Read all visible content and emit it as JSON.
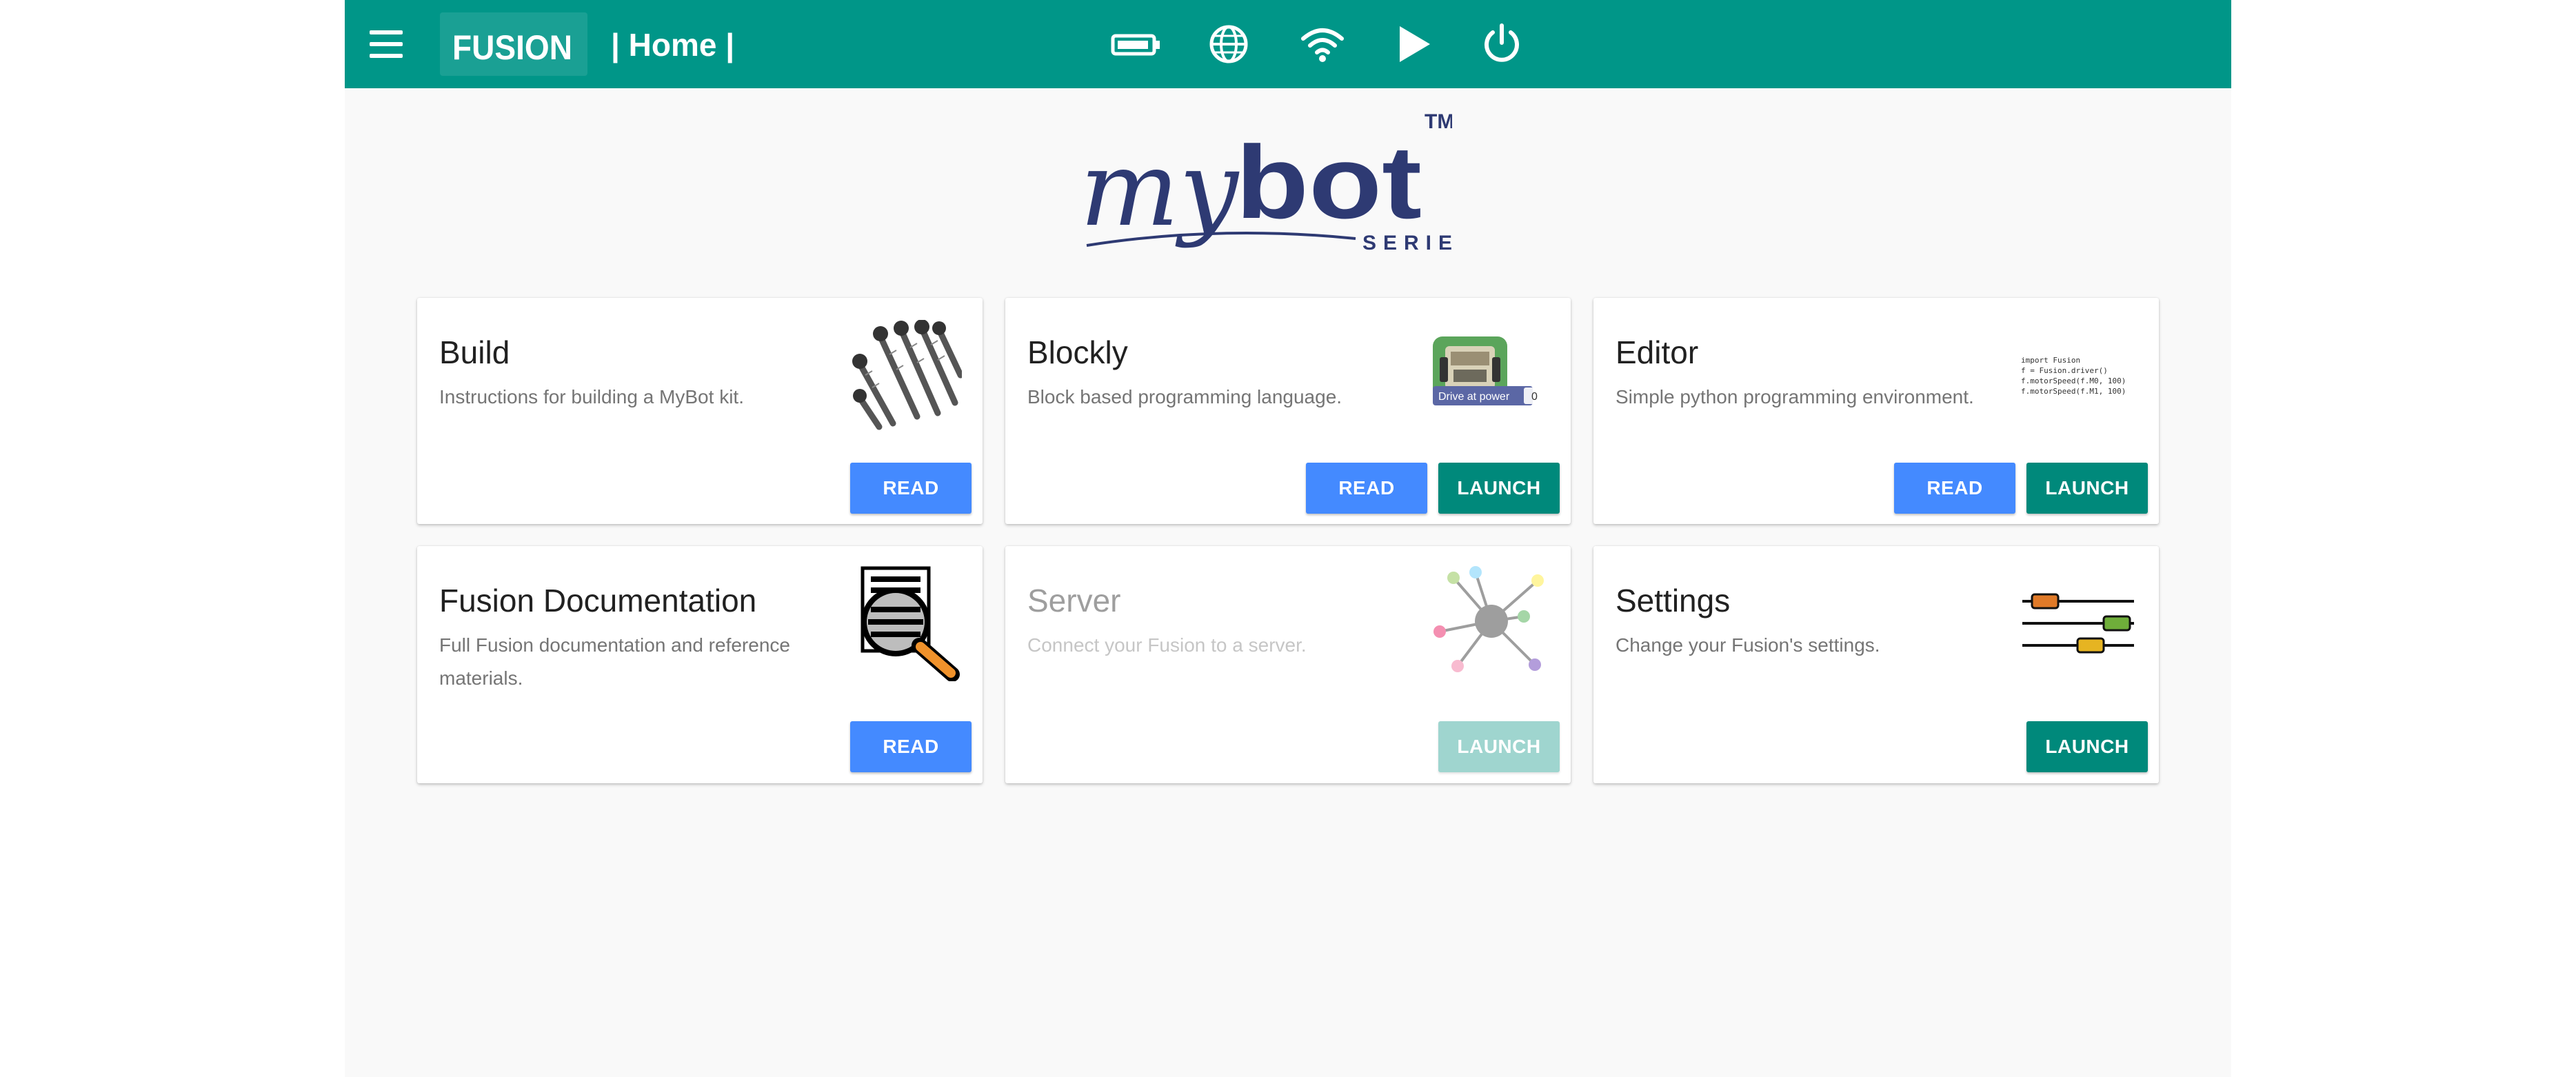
{
  "header": {
    "logo_text": "FUSION",
    "title": "| Home |",
    "icons": [
      "menu-icon",
      "battery-icon",
      "globe-icon",
      "wifi-icon",
      "play-icon",
      "power-icon"
    ]
  },
  "brand": {
    "name_script": "my",
    "name_bold": "bot",
    "tm": "TM",
    "series": "SERIES"
  },
  "cards": [
    {
      "title": "Build",
      "description": "Instructions for building a MyBot kit.",
      "read_label": "READ"
    },
    {
      "title": "Blockly",
      "description": "Block based programming language.",
      "read_label": "READ",
      "launch_label": "LAUNCH",
      "block_text": "Drive at power",
      "block_value": "0"
    },
    {
      "title": "Editor",
      "description": "Simple python programming environment.",
      "read_label": "READ",
      "launch_label": "LAUNCH",
      "code": [
        "import Fusion",
        "f = Fusion.driver()",
        "f.motorSpeed(f.M0, 100)",
        "f.motorSpeed(f.M1, 100)"
      ]
    },
    {
      "title": "Fusion Documentation",
      "description": "Full Fusion documentation and reference materials.",
      "read_label": "READ"
    },
    {
      "title": "Server",
      "description": "Connect your Fusion to a server.",
      "launch_label": "LAUNCH",
      "disabled": true
    },
    {
      "title": "Settings",
      "description": "Change your Fusion's settings.",
      "launch_label": "LAUNCH"
    }
  ],
  "colors": {
    "header": "#009688",
    "read_button": "#448aff",
    "launch_button": "#00897b",
    "brand": "#2e3a73"
  }
}
